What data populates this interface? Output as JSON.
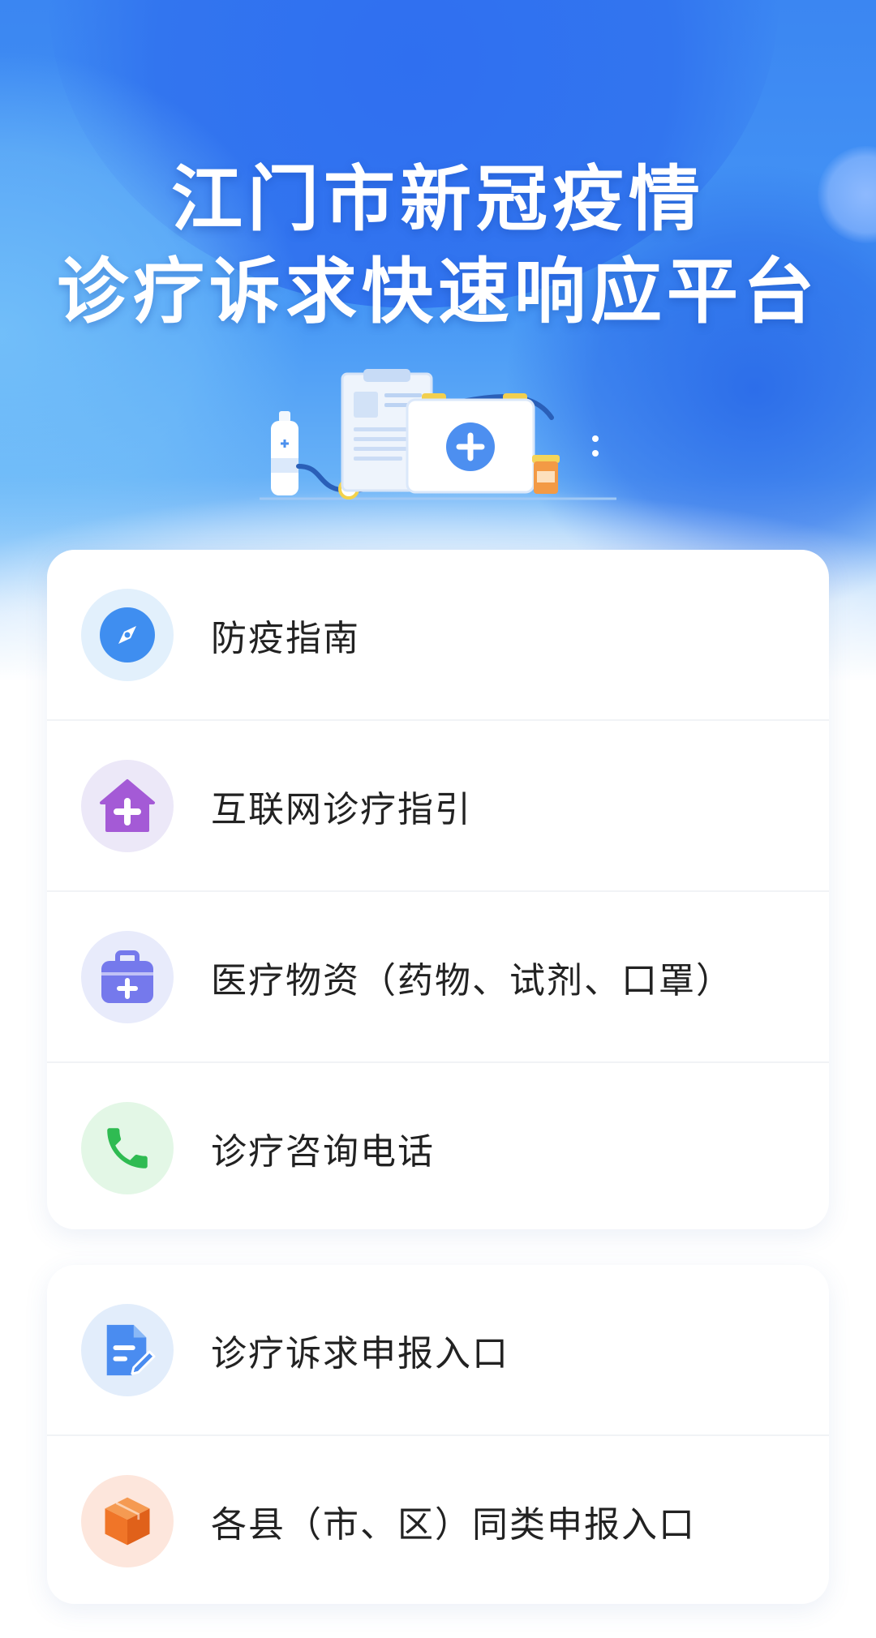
{
  "hero": {
    "title_line1": "江门市新冠疫情",
    "title_line2": "诊疗诉求快速响应平台",
    "colors": {
      "primary": "#3b86f2",
      "deep": "#2f6ff0",
      "light": "#67b1f7"
    }
  },
  "menu_primary": {
    "items": [
      {
        "label": "防疫指南",
        "icon": "compass-icon",
        "icon_bg": "#e2f0fc",
        "icon_color": "#3f8ef0"
      },
      {
        "label": "互联网诊疗指引",
        "icon": "medical-house-icon",
        "icon_bg": "#ece8f8",
        "icon_color": "#a45ad6"
      },
      {
        "label": "医疗物资（药物、试剂、口罩）",
        "icon": "medical-kit-icon",
        "icon_bg": "#e8ebfb",
        "icon_color": "#7579ec"
      },
      {
        "label": "诊疗咨询电话",
        "icon": "phone-icon",
        "icon_bg": "#e3f7e6",
        "icon_color": "#2fbb52"
      }
    ]
  },
  "menu_secondary": {
    "items": [
      {
        "label": "诊疗诉求申报入口",
        "icon": "document-edit-icon",
        "icon_bg": "#e2edfb",
        "icon_color": "#4a8cf0"
      },
      {
        "label": "各县（市、区）同类申报入口",
        "icon": "cube-icon",
        "icon_bg": "#fde6dc",
        "icon_color": "#f07528"
      }
    ]
  }
}
